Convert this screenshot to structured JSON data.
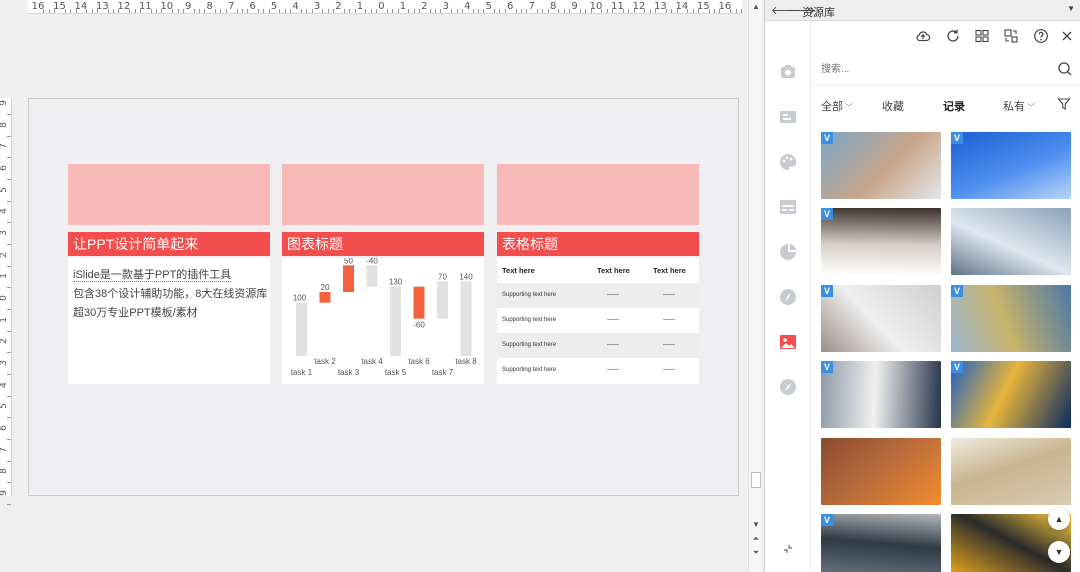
{
  "ruler": {
    "horizontal_labels": [
      "16",
      "15",
      "14",
      "13",
      "12",
      "11",
      "10",
      "9",
      "8",
      "7",
      "6",
      "5",
      "4",
      "3",
      "2",
      "1",
      "0",
      "1",
      "2",
      "3",
      "4",
      "5",
      "6",
      "7",
      "8",
      "9",
      "10",
      "11",
      "12",
      "13",
      "14",
      "15",
      "16"
    ],
    "vertical_labels": [
      "9",
      "8",
      "7",
      "6",
      "5",
      "4",
      "3",
      "2",
      "1",
      "0",
      "1",
      "2",
      "3",
      "4",
      "5",
      "6",
      "7",
      "8",
      "9"
    ]
  },
  "slide": {
    "cards": [
      {
        "title": "让PPT设计简单起来",
        "lines": [
          "iSlide是一款基于PPT的插件工具",
          "包含38个设计辅助功能，8大在线资源库",
          "超30万专业PPT模板/素材"
        ]
      },
      {
        "title": "图表标题"
      },
      {
        "title": "表格标题",
        "table": {
          "headers": [
            "Text here",
            "Text here",
            "Text here"
          ],
          "rows": [
            [
              "Supporting text here",
              "——",
              "——"
            ],
            [
              "Supporting text here",
              "——",
              "——"
            ],
            [
              "Supporting text here",
              "——",
              "——"
            ],
            [
              "Supporting text here",
              "——",
              "——"
            ]
          ]
        }
      }
    ]
  },
  "chart_data": {
    "type": "waterfall",
    "categories": [
      "task 1",
      "task 2",
      "task 3",
      "task 4",
      "task 5",
      "task 6",
      "task 7",
      "task 8"
    ],
    "values": [
      100,
      20,
      50,
      -40,
      130,
      -60,
      70,
      140
    ],
    "labels": [
      "100",
      "20",
      "50",
      "-40",
      "130",
      "-60",
      "70",
      "140"
    ],
    "kinds": [
      "total",
      "delta",
      "delta",
      "delta",
      "total",
      "delta",
      "delta",
      "total"
    ],
    "colors": {
      "total": "#e2e2e2",
      "increase": "#f4613f",
      "decrease": "#f4613f",
      "other": "#e2e2e2"
    },
    "title": "图表标题",
    "ylim": [
      0,
      150
    ]
  },
  "panel": {
    "title": "资源库",
    "search_placeholder": "搜索...",
    "filters": [
      {
        "label": "全部",
        "dropdown": true,
        "active": false
      },
      {
        "label": "收藏",
        "dropdown": false,
        "active": false
      },
      {
        "label": "记录",
        "dropdown": false,
        "active": true
      },
      {
        "label": "私有",
        "dropdown": true,
        "active": false
      }
    ],
    "toolbar_icons": [
      "cloud-upload-icon",
      "refresh-icon",
      "grid-view-icon",
      "replace-icon",
      "help-icon",
      "close-icon"
    ],
    "rail_icons": [
      "theme-icon",
      "card-icon",
      "palette-icon",
      "layout-icon",
      "pie-chart-icon",
      "compass-icon",
      "image-icon",
      "explore-icon"
    ],
    "active_rail": "image-icon",
    "accent_color": "#f44d4d",
    "badge_color": "#3a8ee6",
    "thumbnails": [
      {
        "badge": "V",
        "palette": [
          "#7aa6c9",
          "#c9a68a",
          "#e4e6ea"
        ]
      },
      {
        "badge": "V",
        "palette": [
          "#1a5fd1",
          "#4d8ef0",
          "#b9d4f7"
        ]
      },
      {
        "badge": "V",
        "palette": [
          "#3b2f2a",
          "#d6d0c8",
          "#ffffff"
        ]
      },
      {
        "badge": "",
        "palette": [
          "#8aa1b8",
          "#dfe7ef",
          "#5f7488"
        ]
      },
      {
        "badge": "V",
        "palette": [
          "#cfcfcf",
          "#efefef",
          "#9a8f86"
        ]
      },
      {
        "badge": "V",
        "palette": [
          "#4c78a8",
          "#c8b36a",
          "#9db7d3"
        ]
      },
      {
        "badge": "V",
        "palette": [
          "#26344a",
          "#f0f0f0",
          "#8e9aa8"
        ]
      },
      {
        "badge": "V",
        "palette": [
          "#0a2a63",
          "#e7b53c",
          "#1f5fc4"
        ]
      },
      {
        "badge": "",
        "palette": [
          "#f28c2f",
          "#b56a3c",
          "#8c4a2f"
        ]
      },
      {
        "badge": "",
        "palette": [
          "#d9cbb0",
          "#c9b58f",
          "#f0ebe0"
        ]
      },
      {
        "badge": "V",
        "palette": [
          "#6f7b86",
          "#2f3a44",
          "#b2b8bd"
        ]
      },
      {
        "badge": "",
        "palette": [
          "#f6b21b",
          "#2b2b2b",
          "#ffcf3d"
        ]
      }
    ]
  }
}
